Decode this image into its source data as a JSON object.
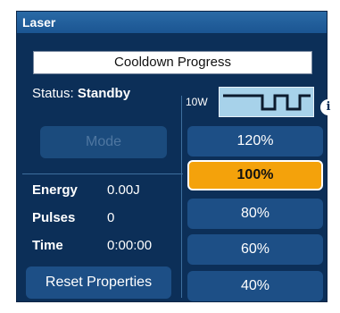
{
  "panel": {
    "title": "Laser"
  },
  "progress": {
    "label": "Cooldown Progress"
  },
  "status": {
    "label": "Status:",
    "value": "Standby"
  },
  "mode": {
    "label": "Mode"
  },
  "stats": {
    "energy": {
      "label": "Energy",
      "value": "0.00J"
    },
    "pulses": {
      "label": "Pulses",
      "value": "0"
    },
    "time": {
      "label": "Time",
      "value": "0:00:00"
    }
  },
  "reset": {
    "label": "Reset Properties"
  },
  "power": {
    "watt_label": "10W",
    "info_icon": "info-icon"
  },
  "power_levels": [
    {
      "label": "120%",
      "selected": false
    },
    {
      "label": "100%",
      "selected": true
    },
    {
      "label": "80%",
      "selected": false
    },
    {
      "label": "60%",
      "selected": false
    },
    {
      "label": "40%",
      "selected": false
    }
  ],
  "colors": {
    "panel_bg": "#0c2f58",
    "button_bg": "#1d4f86",
    "selected_bg": "#f4a20b",
    "pulse_bg": "#a7d2ea"
  }
}
